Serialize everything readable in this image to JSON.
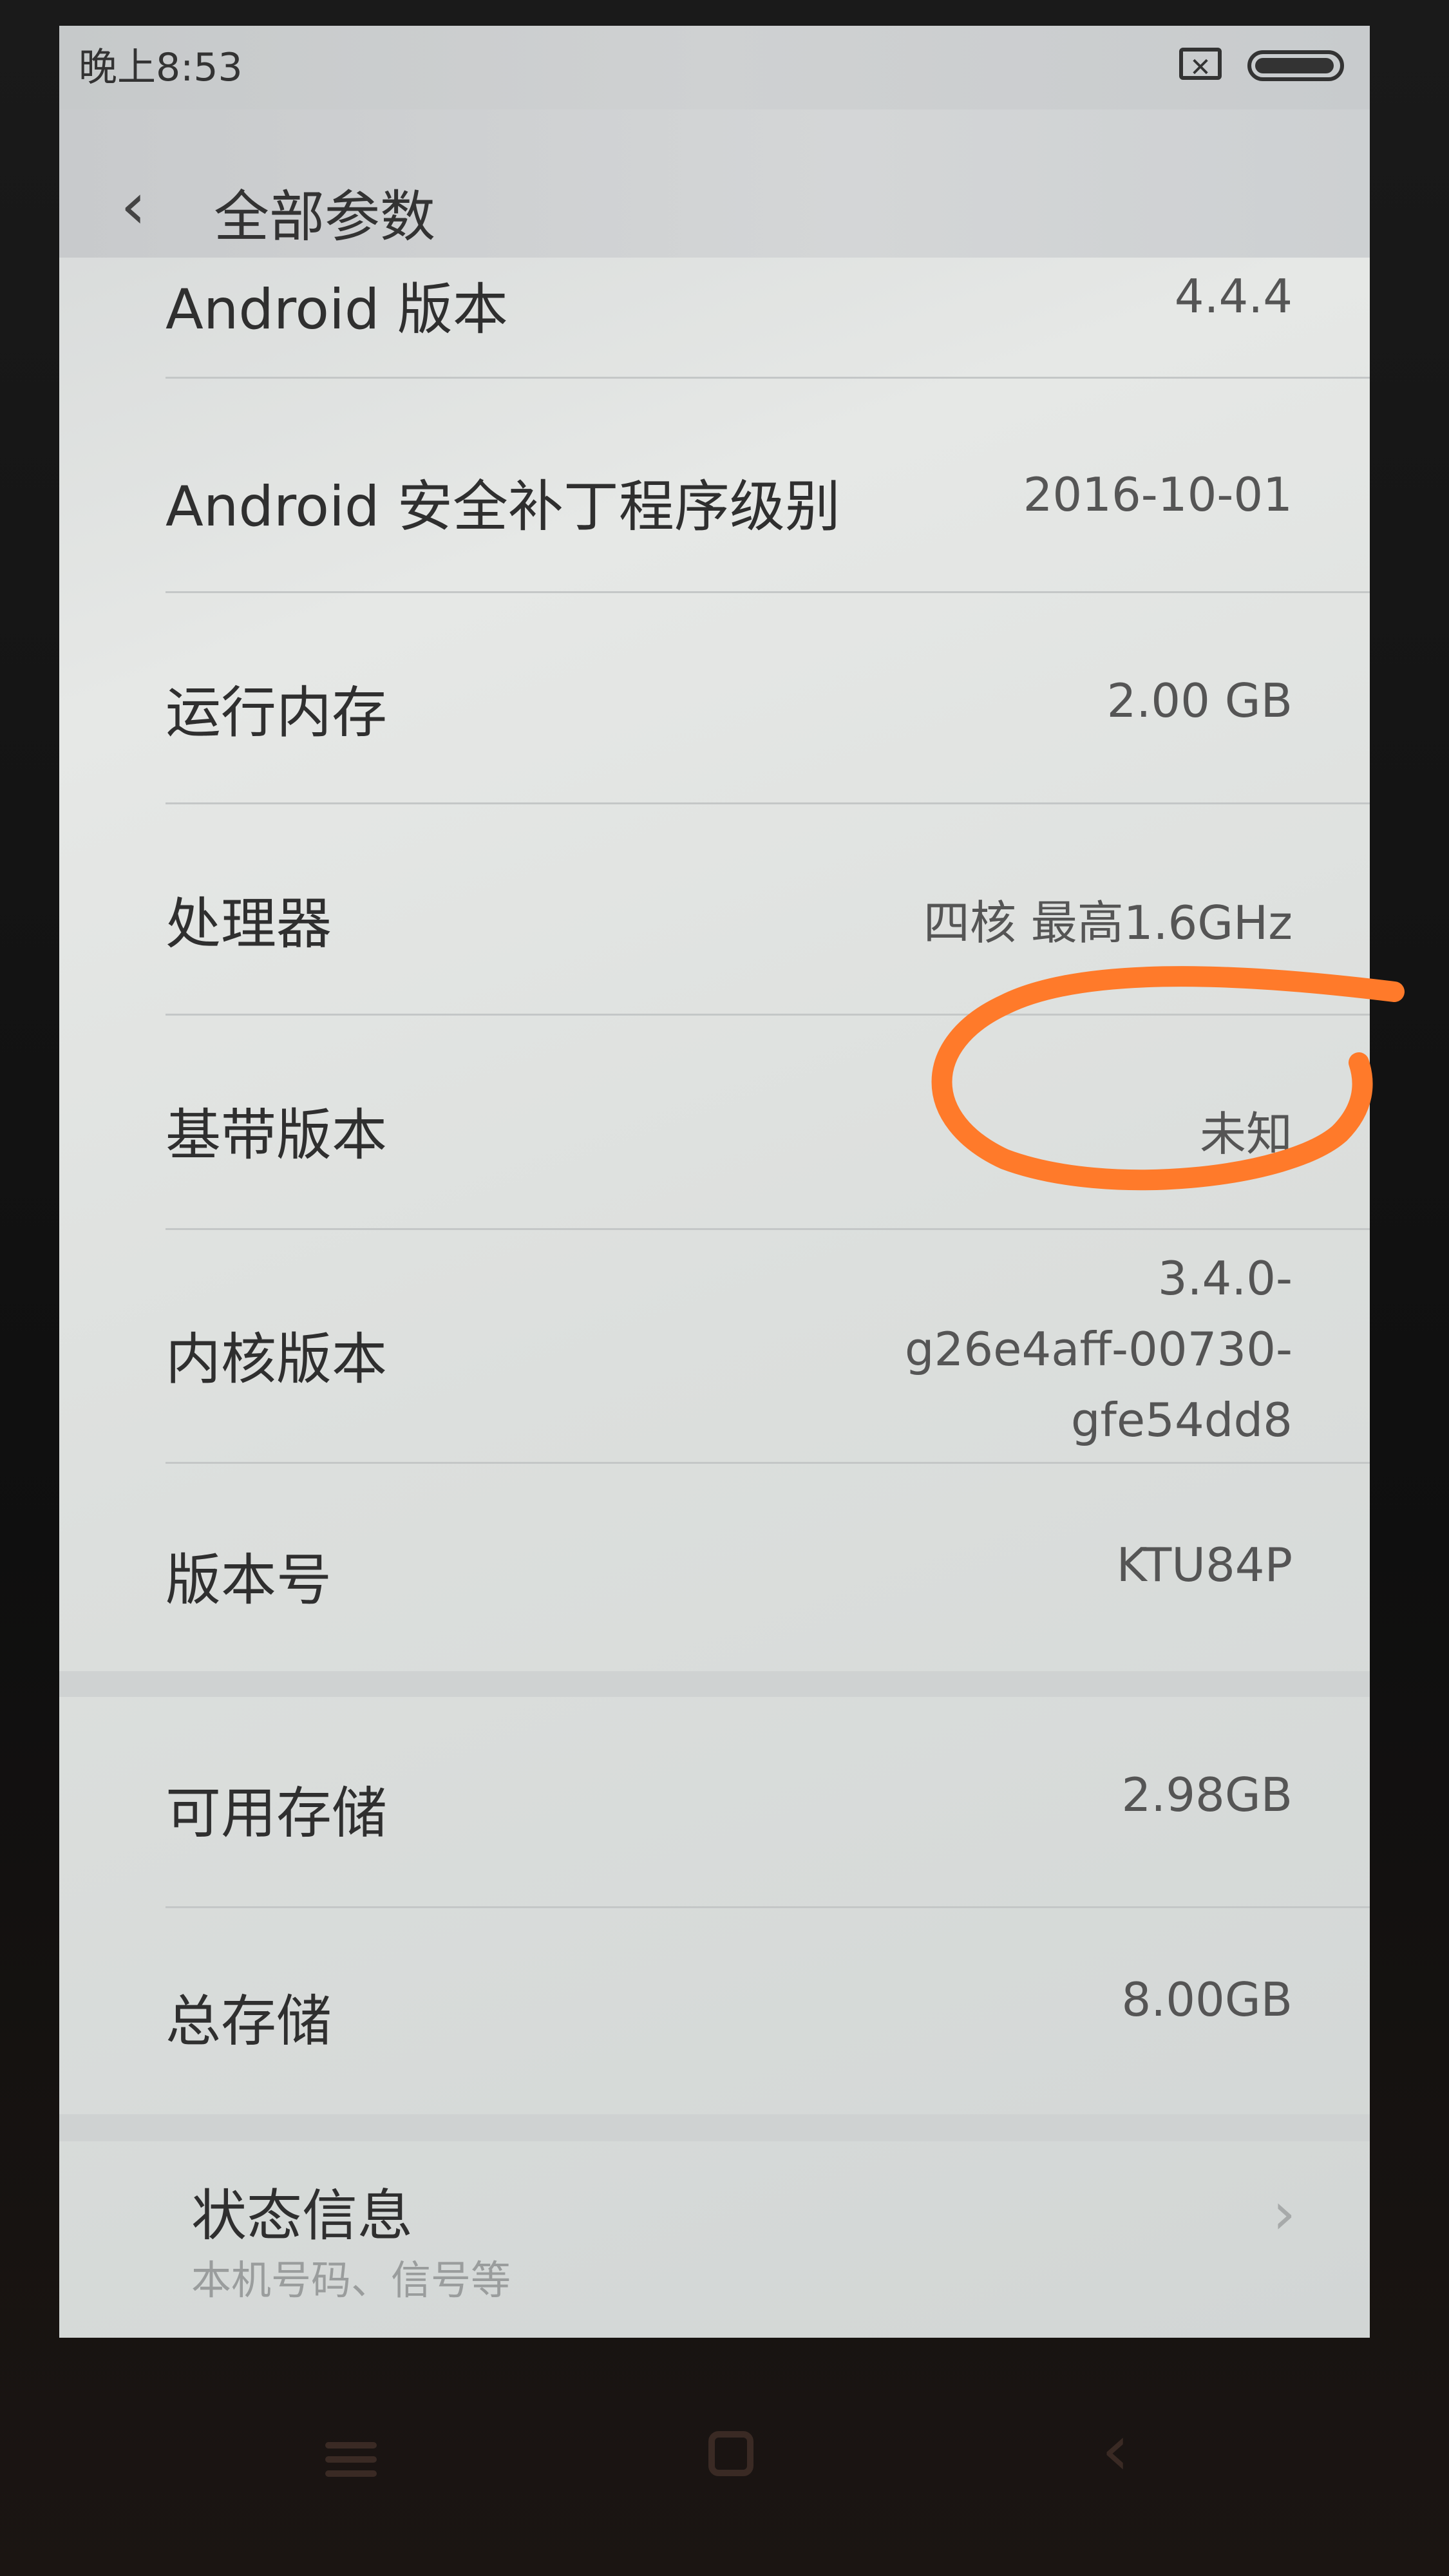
{
  "status_bar": {
    "time": "晚上8:53",
    "sim_icon_glyph": "✕"
  },
  "header": {
    "back_glyph": "‹",
    "title": "全部参数"
  },
  "rows": [
    {
      "label": "Android 版本",
      "value": "4.4.4"
    },
    {
      "label": "Android 安全补丁程序级别",
      "value": "2016-10-01"
    },
    {
      "label": "运行内存",
      "value": "2.00 GB"
    },
    {
      "label": "处理器",
      "value": "四核 最高1.6GHz"
    },
    {
      "label": "基带版本",
      "value": "未知"
    },
    {
      "label": "内核版本",
      "value_lines": [
        "3.4.0-",
        "g26e4aff-00730-",
        "gfe54dd8"
      ]
    },
    {
      "label": "版本号",
      "value": "KTU84P"
    }
  ],
  "storage_rows": [
    {
      "label": "可用存储",
      "value": "2.98GB"
    },
    {
      "label": "总存储",
      "value": "8.00GB"
    }
  ],
  "status_info": {
    "label": "状态信息",
    "subtitle": "本机号码、信号等",
    "chevron_glyph": "›"
  },
  "navbar": {
    "back_glyph": "‹"
  },
  "colors": {
    "annotation": "#ff7a2a",
    "screen_bg": "#dfe2e0",
    "text": "#2f2f2f"
  }
}
